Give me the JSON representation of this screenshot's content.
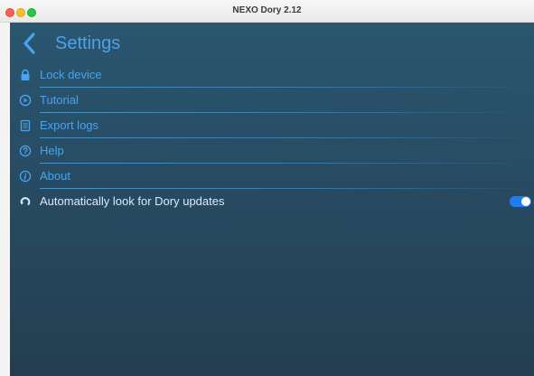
{
  "window": {
    "title": "NEXO Dory 2.12"
  },
  "header": {
    "title": "Settings",
    "back_icon": "chevron-left-icon"
  },
  "menu": {
    "items": [
      {
        "label": "Lock device",
        "icon": "lock-icon"
      },
      {
        "label": "Tutorial",
        "icon": "play-circle-icon"
      },
      {
        "label": "Export logs",
        "icon": "document-icon"
      },
      {
        "label": "Help",
        "icon": "question-circle-icon"
      },
      {
        "label": "About",
        "icon": "info-circle-icon"
      }
    ],
    "auto_update": {
      "label": "Automatically look for Dory updates",
      "icon": "refresh-icon",
      "enabled": true
    }
  },
  "colors": {
    "accent": "#4aa3ee",
    "toggle_on": "#1f7cf2",
    "background_top": "#2a5670",
    "background_bottom": "#243e50"
  }
}
